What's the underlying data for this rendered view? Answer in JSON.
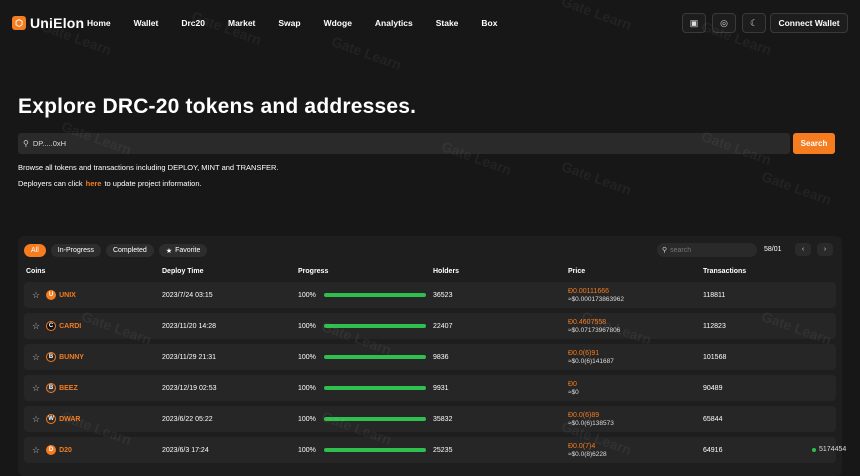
{
  "brand": {
    "name": "UniElon"
  },
  "nav": {
    "items": [
      "Home",
      "Wallet",
      "Drc20",
      "Market",
      "Swap",
      "Wdoge",
      "Analytics",
      "Stake",
      "Box"
    ],
    "connect_label": "Connect Wallet"
  },
  "hero": {
    "title": "Explore DRC-20 tokens and addresses.",
    "search_value": "DP.....0xH",
    "search_button": "Search",
    "desc_line1": "Browse all tokens and transactions including DEPLOY, MINT and TRANSFER.",
    "desc_line2_before": "Deployers can click",
    "desc_link": "here",
    "desc_line2_after": "to update project information."
  },
  "table": {
    "filters": [
      "All",
      "In-Progress",
      "Completed",
      "Favorite"
    ],
    "search_placeholder": "search",
    "page_info": "58/01",
    "headers": [
      "Coins",
      "Deploy Time",
      "Progress",
      "Holders",
      "Price",
      "Transactions"
    ],
    "rows": [
      {
        "coin": "UNIX",
        "icon_color": "#f57c1f",
        "icon_glyph": "U",
        "deploy": "2023/7/24 03:15",
        "progress": "100%",
        "progress_fraction": 1.0,
        "holders": "36523",
        "price": "Ð0.00111666",
        "price_usd": "≈$0.000173863962",
        "tx": "118811"
      },
      {
        "coin": "CARDI",
        "icon_color": "#111111",
        "icon_glyph": "C",
        "deploy": "2023/11/20 14:28",
        "progress": "100%",
        "progress_fraction": 1.0,
        "holders": "22407",
        "price": "Ð0.4607558",
        "price_usd": "≈$0.07173967806",
        "tx": "112823"
      },
      {
        "coin": "BUNNY",
        "icon_color": "#222222",
        "icon_glyph": "B",
        "deploy": "2023/11/29 21:31",
        "progress": "100%",
        "progress_fraction": 1.0,
        "holders": "9836",
        "price": "Ð0.0(6)91",
        "price_usd": "≈$0.0(6)141687",
        "tx": "101568"
      },
      {
        "coin": "BEEZ",
        "icon_color": "#333333",
        "icon_glyph": "B",
        "deploy": "2023/12/19 02:53",
        "progress": "100%",
        "progress_fraction": 1.0,
        "holders": "9931",
        "price": "Ð0",
        "price_usd": "≈$0",
        "tx": "90489"
      },
      {
        "coin": "DWAR",
        "icon_color": "#2b2b2b",
        "icon_glyph": "W",
        "deploy": "2023/6/22 05:22",
        "progress": "100%",
        "progress_fraction": 1.0,
        "holders": "35832",
        "price": "Ð0.0(6)89",
        "price_usd": "≈$0.0(6)138573",
        "tx": "65844"
      },
      {
        "coin": "D20",
        "icon_color": "#f57c1f",
        "icon_glyph": "D",
        "deploy": "2023/6/3 17:24",
        "progress": "100%",
        "progress_fraction": 1.0,
        "holders": "25235",
        "price": "Ð0.0(7)4",
        "price_usd": "≈$0.0(8)6228",
        "tx": "64916"
      }
    ]
  },
  "status": {
    "block": "5174454"
  },
  "watermark": "Gate Learn"
}
